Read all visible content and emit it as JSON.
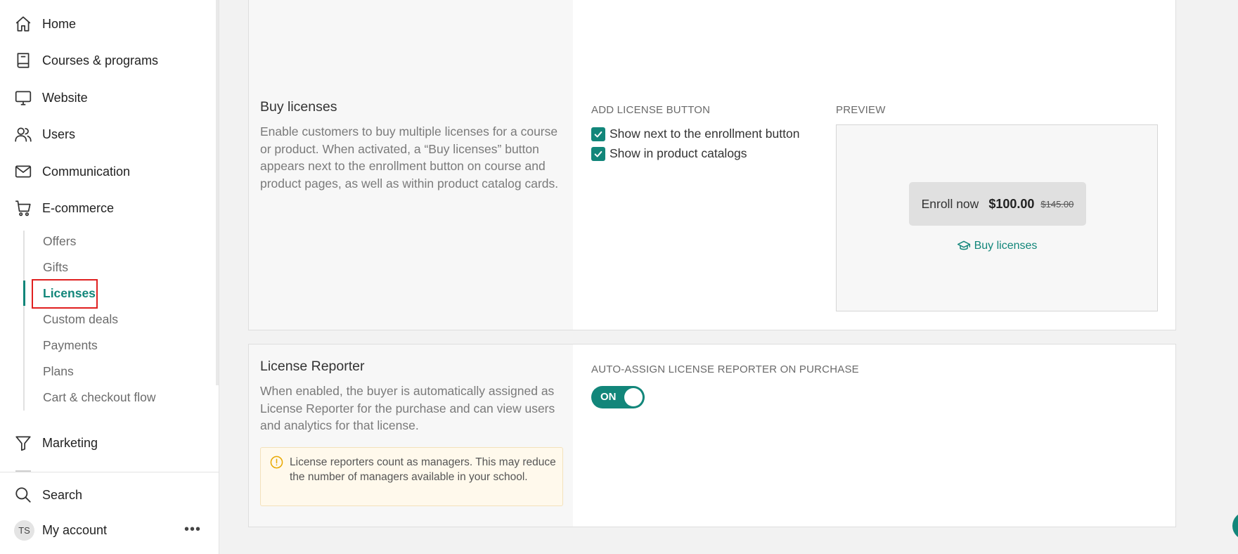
{
  "sidebar": {
    "items": [
      {
        "label": "Home",
        "icon": "home-icon"
      },
      {
        "label": "Courses & programs",
        "icon": "book-icon"
      },
      {
        "label": "Website",
        "icon": "monitor-icon"
      },
      {
        "label": "Users",
        "icon": "users-icon"
      },
      {
        "label": "Communication",
        "icon": "mail-icon"
      },
      {
        "label": "E-commerce",
        "icon": "cart-icon"
      },
      {
        "label": "Marketing",
        "icon": "funnel-icon"
      }
    ],
    "ecommerce_subitems": [
      {
        "label": "Offers"
      },
      {
        "label": "Gifts"
      },
      {
        "label": "Licenses",
        "active": true
      },
      {
        "label": "Custom deals"
      },
      {
        "label": "Payments"
      },
      {
        "label": "Plans"
      },
      {
        "label": "Cart & checkout flow"
      }
    ],
    "search_label": "Search",
    "account": {
      "initials": "TS",
      "label": "My account",
      "more": "•••"
    }
  },
  "buy_licenses": {
    "title": "Buy licenses",
    "description": "Enable customers to buy multiple licenses for a course or product. When activated, a “Buy licenses” button appears next to the enrollment button on course and product pages, as well as within product catalog cards.",
    "add_button_label": "ADD LICENSE BUTTON",
    "options": [
      {
        "label": "Show next to the enrollment button",
        "checked": true
      },
      {
        "label": "Show in product catalogs",
        "checked": true
      }
    ],
    "preview_label": "PREVIEW",
    "preview": {
      "enroll_text": "Enroll now",
      "price": "$100.00",
      "old_price": "$145.00",
      "buy_link": "Buy licenses"
    }
  },
  "license_reporter": {
    "title": "License Reporter",
    "description": "When enabled, the buyer is automatically assigned as License Reporter for the purchase and can view users and analytics for that license.",
    "warning": "License reporters count as managers. This may reduce the number of managers available in your school.",
    "auto_assign_label": "AUTO-ASSIGN LICENSE REPORTER ON PURCHASE",
    "toggle_label": "ON",
    "toggle_on": true
  },
  "colors": {
    "accent": "#12867a",
    "highlight": "#e02020",
    "warning_bg": "#fff9ec"
  }
}
